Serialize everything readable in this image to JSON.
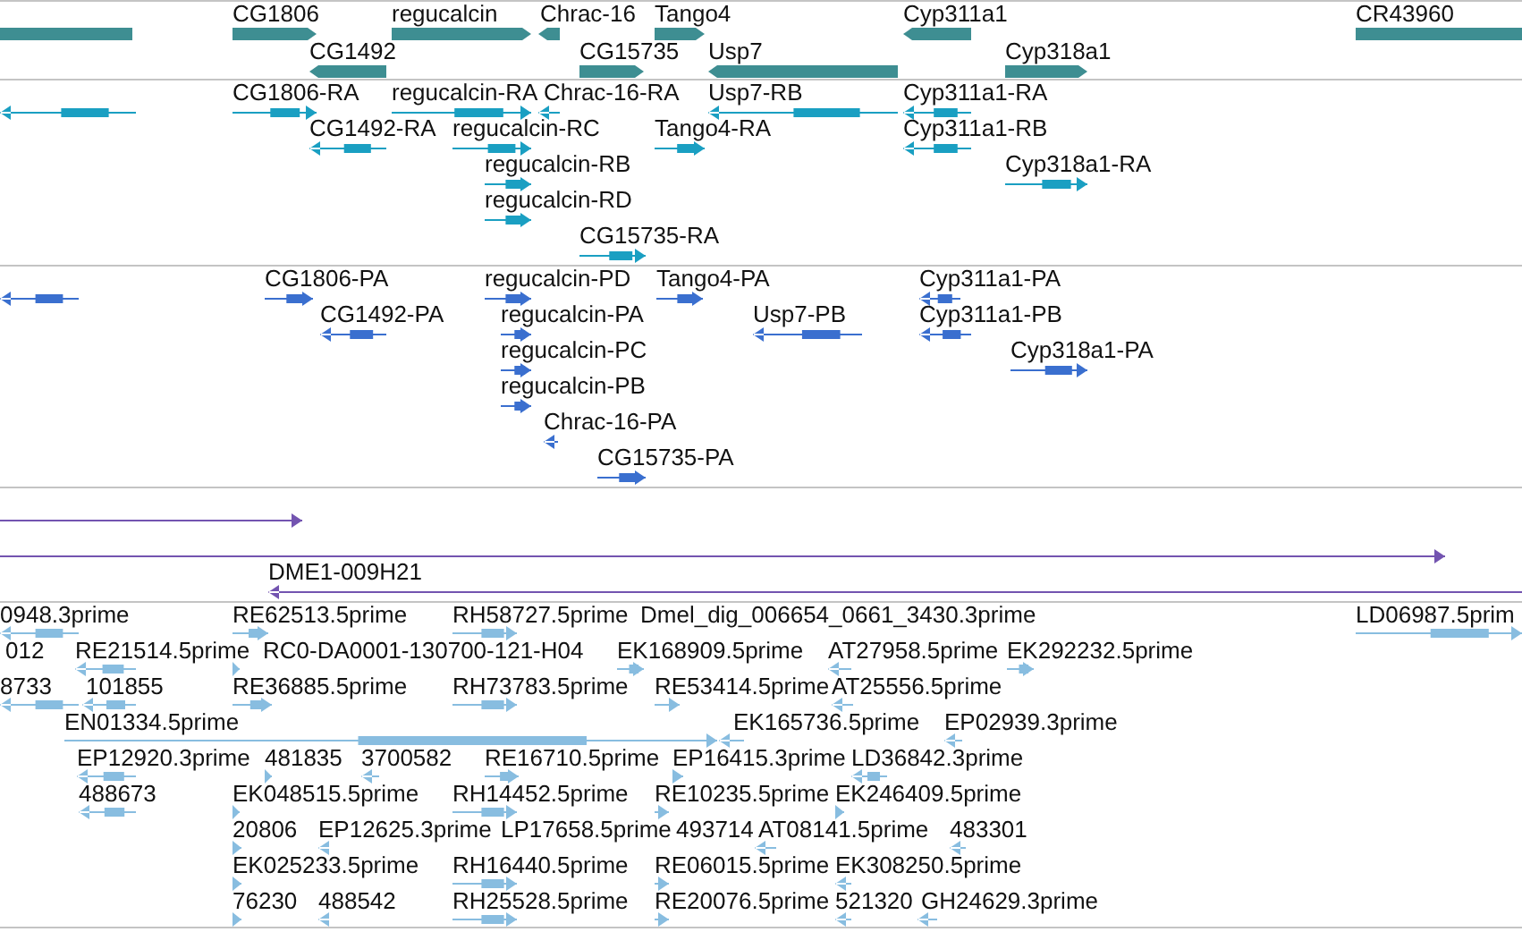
{
  "tracks": [
    {
      "kind": "gene",
      "features": [
        {
          "arrow": false
        },
        {
          "label": "CG1806",
          "reverse": false
        },
        {
          "label": "regucalcin",
          "reverse": false
        },
        {
          "label": "Chrac-16",
          "reverse": true
        },
        {
          "label": "Tango4",
          "reverse": false
        },
        {
          "label": "Cyp311a1",
          "reverse": true
        },
        {
          "label": "CR43960",
          "arrow": false
        },
        {
          "label": "CG1492",
          "reverse": true
        },
        {
          "label": "CG15735",
          "reverse": false
        },
        {
          "label": "Usp7",
          "reverse": true
        },
        {
          "label": "Cyp318a1",
          "reverse": false
        }
      ]
    },
    {
      "kind": "transcript",
      "features": [
        {
          "reverse": true
        },
        {
          "label": "CG1806-RA",
          "reverse": false
        },
        {
          "label": "regucalcin-RA",
          "reverse": false
        },
        {
          "label": "Chrac-16-RA",
          "reverse": true
        },
        {
          "label": "Usp7-RB",
          "reverse": true
        },
        {
          "label": "Cyp311a1-RA",
          "reverse": true
        },
        {
          "label": "CG1492-RA",
          "reverse": true
        },
        {
          "label": "regucalcin-RC",
          "reverse": false
        },
        {
          "label": "Tango4-RA",
          "reverse": false
        },
        {
          "label": "Cyp311a1-RB",
          "reverse": true
        },
        {
          "label": "regucalcin-RB",
          "reverse": false
        },
        {
          "label": "Cyp318a1-RA",
          "reverse": false
        },
        {
          "label": "regucalcin-RD",
          "reverse": false
        },
        {
          "label": "CG15735-RA",
          "reverse": false
        }
      ]
    },
    {
      "kind": "protein",
      "features": [
        {
          "reverse": true
        },
        {
          "label": "CG1806-PA",
          "reverse": false
        },
        {
          "label": "regucalcin-PD",
          "reverse": false
        },
        {
          "label": "Tango4-PA",
          "reverse": false
        },
        {
          "label": "Cyp311a1-PA",
          "reverse": true
        },
        {
          "label": "CG1492-PA",
          "reverse": true
        },
        {
          "label": "regucalcin-PA",
          "reverse": false
        },
        {
          "label": "Usp7-PB",
          "reverse": true
        },
        {
          "label": "Cyp311a1-PB",
          "reverse": true
        },
        {
          "label": "regucalcin-PC",
          "reverse": false
        },
        {
          "label": "Cyp318a1-PA",
          "reverse": false
        },
        {
          "label": "regucalcin-PB",
          "reverse": false
        },
        {
          "label": "Chrac-16-PA",
          "reverse": true
        },
        {
          "label": "CG15735-PA",
          "reverse": false
        }
      ]
    },
    {
      "kind": "clone",
      "features": [
        {
          "reverse": false
        },
        {
          "reverse": false
        },
        {
          "label": "DME1-009H21",
          "reverse": true
        }
      ]
    },
    {
      "kind": "est",
      "features": [
        {
          "label": "0948.3prime",
          "reverse": true
        },
        {
          "label": "RE62513.5prime",
          "reverse": false
        },
        {
          "label": "RH58727.5prime",
          "reverse": false
        },
        {
          "label": "Dmel_dig_006654_0661_3430.3prime"
        },
        {
          "label": "LD06987.5prim",
          "reverse": false
        },
        {
          "label": "012"
        },
        {
          "label": "RE21514.5prime",
          "reverse": true
        },
        {
          "label": "RC0-DA0001-130700-121-H04",
          "reverse": false
        },
        {
          "label": "EK168909.5prime",
          "reverse": false
        },
        {
          "label": "AT27958.5prime",
          "reverse": true
        },
        {
          "label": "EK292232.5prime",
          "reverse": false
        },
        {
          "label": "8733",
          "reverse": true
        },
        {
          "label": "101855",
          "reverse": true
        },
        {
          "label": "RE36885.5prime",
          "reverse": false
        },
        {
          "label": "RH73783.5prime",
          "reverse": false
        },
        {
          "label": "RE53414.5prime",
          "reverse": false
        },
        {
          "label": "AT25556.5prime",
          "reverse": true
        },
        {
          "label": "EN01334.5prime",
          "reverse": false
        },
        {
          "label": "EK165736.5prime",
          "reverse": true
        },
        {
          "label": "EP02939.3prime",
          "reverse": true
        },
        {
          "label": "EP12920.3prime",
          "reverse": true
        },
        {
          "label": "481835",
          "reverse": false
        },
        {
          "label": "3700582",
          "reverse": true
        },
        {
          "label": "RE16710.5prime",
          "reverse": false
        },
        {
          "label": "EP16415.3prime",
          "reverse": false
        },
        {
          "label": "LD36842.3prime",
          "reverse": true
        },
        {
          "label": "488673",
          "reverse": true
        },
        {
          "label": "EK048515.5prime",
          "reverse": false
        },
        {
          "label": "RH14452.5prime",
          "reverse": false
        },
        {
          "label": "RE10235.5prime",
          "reverse": false
        },
        {
          "label": "EK246409.5prime",
          "reverse": false
        },
        {
          "label": "20806",
          "reverse": false
        },
        {
          "label": "EP12625.3prime",
          "reverse": true
        },
        {
          "label": "LP17658.5prime"
        },
        {
          "label": "493714"
        },
        {
          "label": "AT08141.5prime",
          "reverse": true
        },
        {
          "label": "483301",
          "reverse": true
        },
        {
          "label": "EK025233.5prime",
          "reverse": false
        },
        {
          "label": "RH16440.5prime",
          "reverse": false
        },
        {
          "label": "RE06015.5prime",
          "reverse": false
        },
        {
          "label": "EK308250.5prime",
          "reverse": true
        },
        {
          "label": "76230",
          "reverse": false
        },
        {
          "label": "488542",
          "reverse": true
        },
        {
          "label": "RH25528.5prime",
          "reverse": false
        },
        {
          "label": "RE20076.5prime",
          "reverse": false
        },
        {
          "label": "521320",
          "reverse": true
        },
        {
          "label": "GH24629.3prime",
          "reverse": true
        }
      ]
    }
  ]
}
